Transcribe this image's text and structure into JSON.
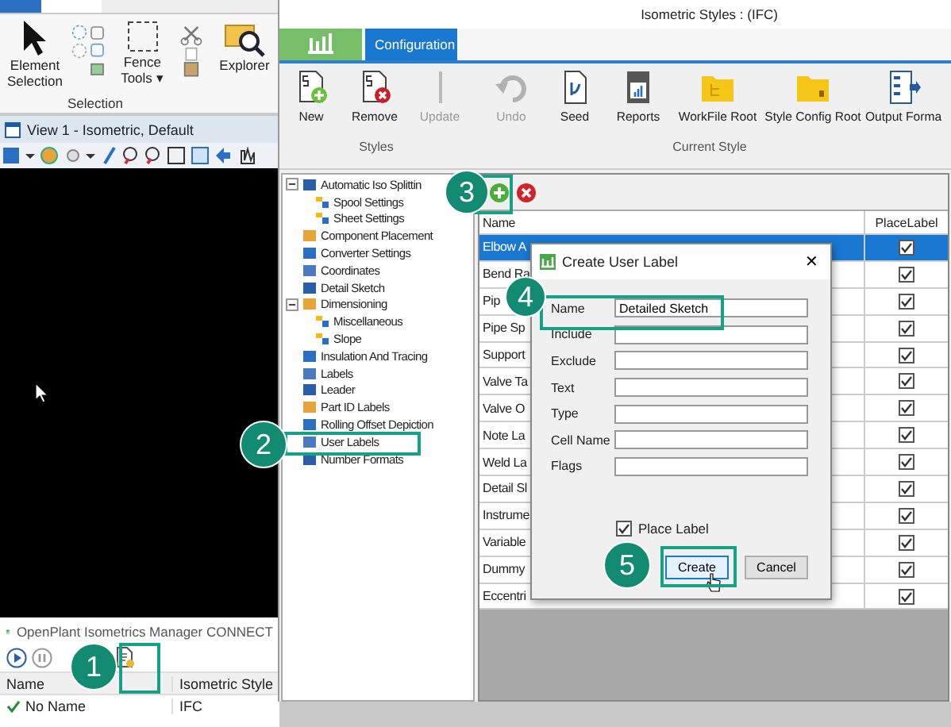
{
  "background_app": {
    "ribbon": {
      "buttons": [
        {
          "label": "Element Selection"
        },
        {
          "label": "Fence Tools ▾"
        },
        {
          "label": "Explorer"
        }
      ],
      "group_label": "Selection"
    },
    "view": {
      "title": "View 1 - Isometric, Default"
    },
    "manager": {
      "title": "OpenPlant Isometrics Manager CONNECT",
      "columns": [
        "Name",
        "Isometric Style"
      ],
      "rows": [
        {
          "name": "No Name",
          "style": "IFC"
        }
      ]
    }
  },
  "styles_window": {
    "title": "Isometric Styles : (IFC)",
    "tabs": [
      {
        "kind": "app",
        "selected": false
      },
      {
        "label": "Configuration",
        "kind": "text",
        "selected": true
      }
    ],
    "ribbon_groups": [
      {
        "label": "Styles",
        "buttons": [
          {
            "label": "New",
            "disabled": false
          },
          {
            "label": "Remove",
            "disabled": false
          },
          {
            "label": "Update",
            "disabled": true
          }
        ]
      },
      {
        "label": "Current Style",
        "buttons": [
          {
            "label": "Undo",
            "disabled": true
          },
          {
            "label": "Seed",
            "disabled": false
          },
          {
            "label": "Reports",
            "disabled": false
          },
          {
            "label": "WorkFile Root",
            "disabled": false
          },
          {
            "label": "Style Config Root",
            "disabled": false
          },
          {
            "label": "Output Forma",
            "disabled": false
          }
        ]
      }
    ],
    "tree": [
      {
        "label": "Automatic Iso Splittin",
        "expanded": true,
        "children": [
          {
            "label": "Spool Settings"
          },
          {
            "label": "Sheet Settings"
          }
        ]
      },
      {
        "label": "Component Placement"
      },
      {
        "label": "Converter Settings"
      },
      {
        "label": "Coordinates"
      },
      {
        "label": "Detail Sketch"
      },
      {
        "label": "Dimensioning",
        "expanded": true,
        "children": [
          {
            "label": "Miscellaneous"
          },
          {
            "label": "Slope"
          }
        ]
      },
      {
        "label": "Insulation And Tracing"
      },
      {
        "label": "Labels"
      },
      {
        "label": "Leader"
      },
      {
        "label": "Part ID Labels"
      },
      {
        "label": "Rolling Offset Depiction"
      },
      {
        "label": "User Labels"
      },
      {
        "label": "Number Formats"
      }
    ],
    "grid": {
      "columns": [
        "Name",
        "PlaceLabel"
      ],
      "rows": [
        {
          "name": "Elbow A",
          "place_label": true,
          "selected": true
        },
        {
          "name": "Bend Ra",
          "place_label": true,
          "selected": false
        },
        {
          "name": "Pip",
          "place_label": true,
          "selected": false
        },
        {
          "name": "Pipe Sp",
          "place_label": true,
          "selected": false
        },
        {
          "name": "Support",
          "place_label": true,
          "selected": false
        },
        {
          "name": "Valve Ta",
          "place_label": true,
          "selected": false
        },
        {
          "name": "Valve O",
          "place_label": true,
          "selected": false
        },
        {
          "name": "Note La",
          "place_label": true,
          "selected": false
        },
        {
          "name": "Weld La",
          "place_label": true,
          "selected": false
        },
        {
          "name": "Detail Sl",
          "place_label": true,
          "selected": false
        },
        {
          "name": "Instrume",
          "place_label": true,
          "selected": false
        },
        {
          "name": "Variable",
          "place_label": true,
          "selected": false
        },
        {
          "name": "Dummy",
          "place_label": true,
          "selected": false
        },
        {
          "name": "Eccentri",
          "place_label": true,
          "selected": false
        }
      ]
    }
  },
  "dialog": {
    "title": "Create User Label",
    "close": "✕",
    "fields": [
      {
        "label": "Name",
        "value": "Detailed Sketch"
      },
      {
        "label": "Include"
      },
      {
        "label": "Exclude"
      },
      {
        "label": "Text"
      },
      {
        "label": "Type"
      },
      {
        "label": "Cell Name"
      },
      {
        "label": "Flags"
      }
    ],
    "checkbox": {
      "label": "Place Label",
      "checked": true
    },
    "buttons": [
      {
        "label": "Create",
        "focused": true
      },
      {
        "label": "Cancel",
        "focused": false
      }
    ]
  },
  "callouts": [
    {
      "number": "1"
    },
    {
      "number": "2"
    },
    {
      "number": "3"
    },
    {
      "number": "4"
    },
    {
      "number": "5"
    }
  ]
}
